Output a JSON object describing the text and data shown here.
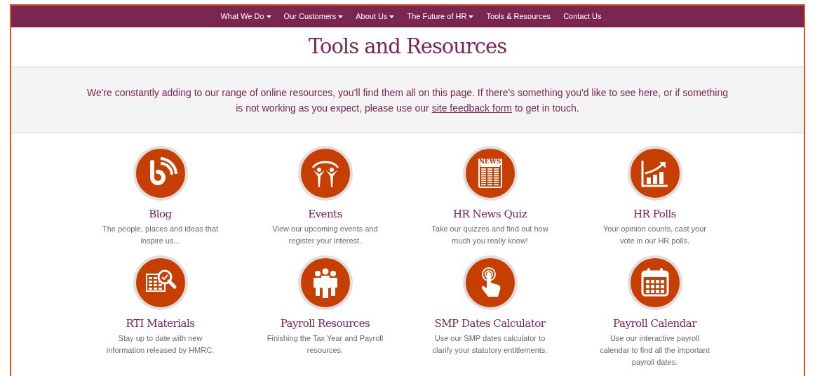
{
  "nav": [
    {
      "label": "What We Do",
      "dropdown": true
    },
    {
      "label": "Our Customers",
      "dropdown": true
    },
    {
      "label": "About Us",
      "dropdown": true
    },
    {
      "label": "The Future of HR",
      "dropdown": true
    },
    {
      "label": "Tools & Resources",
      "dropdown": false
    },
    {
      "label": "Contact Us",
      "dropdown": false
    }
  ],
  "title": "Tools and Resources",
  "intro": {
    "before": "We're constantly adding to our range of online resources, you'll find them all on this page. If there's something you'd like to see here, or if something is not working as you expect, please use our",
    "link": "site feedback form",
    "after": "to get in touch."
  },
  "tiles": [
    {
      "kind": "blog",
      "title": "Blog",
      "description": "The people, places and ideas that inspire us..."
    },
    {
      "kind": "events",
      "title": "Events",
      "description": "View our upcoming events and register your interest."
    },
    {
      "kind": "news",
      "title": "HR News Quiz",
      "description": "Take our quizzes and find out how much you really know!",
      "icon_text": "NEWS"
    },
    {
      "kind": "polls",
      "title": "HR Polls",
      "description": "Your opinion counts, cast your vote in our HR polls."
    },
    {
      "kind": "rti",
      "title": "RTI Materials",
      "description": "Stay up to date with new information released by HMRC."
    },
    {
      "kind": "people",
      "title": "Payroll Resources",
      "description": "Finishing the Tax Year and Payroll resources."
    },
    {
      "kind": "touch",
      "title": "SMP Dates Calculator",
      "description": "Use our SMP dates calculator to clarify your statutory entitlements."
    },
    {
      "kind": "calendar",
      "title": "Payroll Calendar",
      "description": "Use our interactive payroll calendar to find all the important payroll dates."
    }
  ]
}
